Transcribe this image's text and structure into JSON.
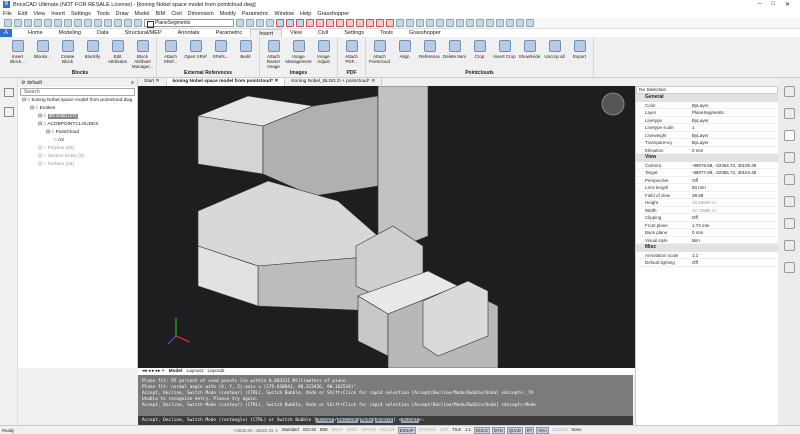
{
  "title": "BricsCAD Ultimate (NOT FOR RESALE License) - [koning Nobel space model from pointcloud.dwg]",
  "menu": [
    "File",
    "Edit",
    "View",
    "Insert",
    "Settings",
    "Tools",
    "Draw",
    "Model",
    "BIM",
    "Civil",
    "Dimension",
    "Modify",
    "Parametric",
    "Window",
    "Help",
    "Grasshopper"
  ],
  "layer": "PlaneSegments",
  "ribbon_tabs": [
    "Home",
    "Modeling",
    "Data",
    "Structural/MEP",
    "Annotate",
    "Parametric",
    "Insert",
    "View",
    "Civil",
    "Settings",
    "Tools",
    "Grasshopper"
  ],
  "active_tab": "Insert",
  "groups": [
    {
      "label": "Blocks",
      "buttons": [
        "Insert Block...",
        "Blocks...",
        "Create Block",
        "Blockify",
        "Edit Attributes",
        "Block Attribute Manager..."
      ]
    },
    {
      "label": "External References",
      "buttons": [
        "Attach XRef...",
        "Open XRef",
        "XRefs...",
        "Bedit"
      ]
    },
    {
      "label": "Images",
      "buttons": [
        "Attach Raster Image",
        "Image Management",
        "Image Adjust"
      ]
    },
    {
      "label": "PDF",
      "buttons": [
        "Attach PDF..."
      ]
    },
    {
      "label": "Pointclouds",
      "buttons": [
        "Attach Pointcloud",
        "Align",
        "Reference",
        "Delete Item",
        "Crop",
        "Invert Crop",
        "Show/Hide",
        "Uncrop all",
        "Export"
      ]
    }
  ],
  "structure": {
    "profile": "default",
    "search_placeholder": "Search",
    "nodes": [
      {
        "label": "koning Nobel space model from pointcloud.dwg",
        "level": 0,
        "dim": false
      },
      {
        "label": "Entities",
        "level": 1,
        "dim": false
      },
      {
        "label": "3D Solid (17)",
        "level": 2,
        "dim": false,
        "selected": true
      },
      {
        "label": "ACDBPOINTCLOUDEX",
        "level": 2,
        "dim": false
      },
      {
        "label": "PointCloud",
        "level": 3,
        "dim": false
      },
      {
        "label": "A3",
        "level": 4,
        "dim": false
      },
      {
        "label": "Polyline (62)",
        "level": 2,
        "dim": true
      },
      {
        "label": "Section Entity (3)",
        "level": 2,
        "dim": true
      },
      {
        "label": "Surface (34)",
        "level": 2,
        "dim": true
      }
    ]
  },
  "doc_tabs": [
    "Start",
    "koning Nobel space model from pointcloud*",
    "Koning Nobel_BLDG D + pointcloud*"
  ],
  "layout_tabs": [
    "Model",
    "Layout1",
    "Layout2"
  ],
  "command_history": [
    "Plane fit: 95 percent of used points lie within 0.003221 Millimeters of plane.",
    "Plane fit: normal angle with (X, Y, Z)-axis = (179.638041, 90.323426, 90.162510)°.",
    "Accept, Decline, Switch Mode (contour) (CTRL), Switch Bubble, Undo or Shift+Click for rapid selection [Accept/Decline/Mode/Bubble/Undo] <Accept>:_TX",
    "Unable to recognize entry. Please try again.",
    "Accept, Decline, Switch Mode (contour) (CTRL), Switch Bubble, Undo or Shift+Click for rapid selection [Accept/Decline/Mode/Bubble/Undo] <Accept>:Mode"
  ],
  "command_prompt": {
    "text": "Accept, Decline, Switch Mode (rectangle) (CTRL) or Switch Bubble [",
    "options": [
      "Accept",
      "Decline",
      "Mode",
      "Bubble"
    ],
    "default": "Accept",
    "suffix": ">:"
  },
  "properties": {
    "selection": "No Selection",
    "sections": [
      {
        "name": "General",
        "rows": [
          [
            "Color",
            "ByLayer"
          ],
          [
            "Layer",
            "PlaneSegments"
          ],
          [
            "Linetype",
            "ByLayer"
          ],
          [
            "Linetype scale",
            "1"
          ],
          [
            "Lineweight",
            "ByLayer"
          ],
          [
            "Transparency",
            "ByLayer"
          ],
          [
            "Elevation",
            "0 mm"
          ]
        ]
      },
      {
        "name": "View",
        "rows": [
          [
            "Camera",
            "-88076.69, -22364.72, 30105.48"
          ],
          [
            "Target",
            "-88077.69, -22365.72, 30104.48"
          ],
          [
            "Perspective",
            "Off"
          ],
          [
            "Lens length",
            "50 mm"
          ],
          [
            "Field of view",
            "38.58"
          ],
          [
            "Height",
            "18.68906 m"
          ],
          [
            "Width",
            "32.70985 m"
          ],
          [
            "Clipping",
            "Off"
          ],
          [
            "Front plane",
            "1.73 mm"
          ],
          [
            "Back plane",
            "0 mm"
          ],
          [
            "Visual style",
            "Bim"
          ]
        ]
      },
      {
        "name": "Misc",
        "rows": [
          [
            "Annotation scale",
            "1:1"
          ],
          [
            "Default lighting",
            "Off"
          ]
        ]
      }
    ]
  },
  "status": {
    "ready": "Ready",
    "coords": "-74638.28, -40620.33, 0",
    "items": [
      "Standard",
      "ISO-25",
      "BIM",
      "SNAP",
      "GRID",
      "ORTHO",
      "POLAR",
      "ESNAP",
      "STRACK",
      "LWT",
      "TILE",
      "1:1",
      "DUCS",
      "DYN",
      "QUAD",
      "RT",
      "HKA",
      "LOCKUI",
      "None"
    ],
    "on": [
      "ESNAP",
      "DUCS",
      "DYN",
      "QUAD",
      "RT",
      "HKA"
    ],
    "off": [
      "SNAP",
      "GRID",
      "ORTHO",
      "POLAR",
      "STRACK",
      "LWT",
      "LOCKUI"
    ]
  }
}
